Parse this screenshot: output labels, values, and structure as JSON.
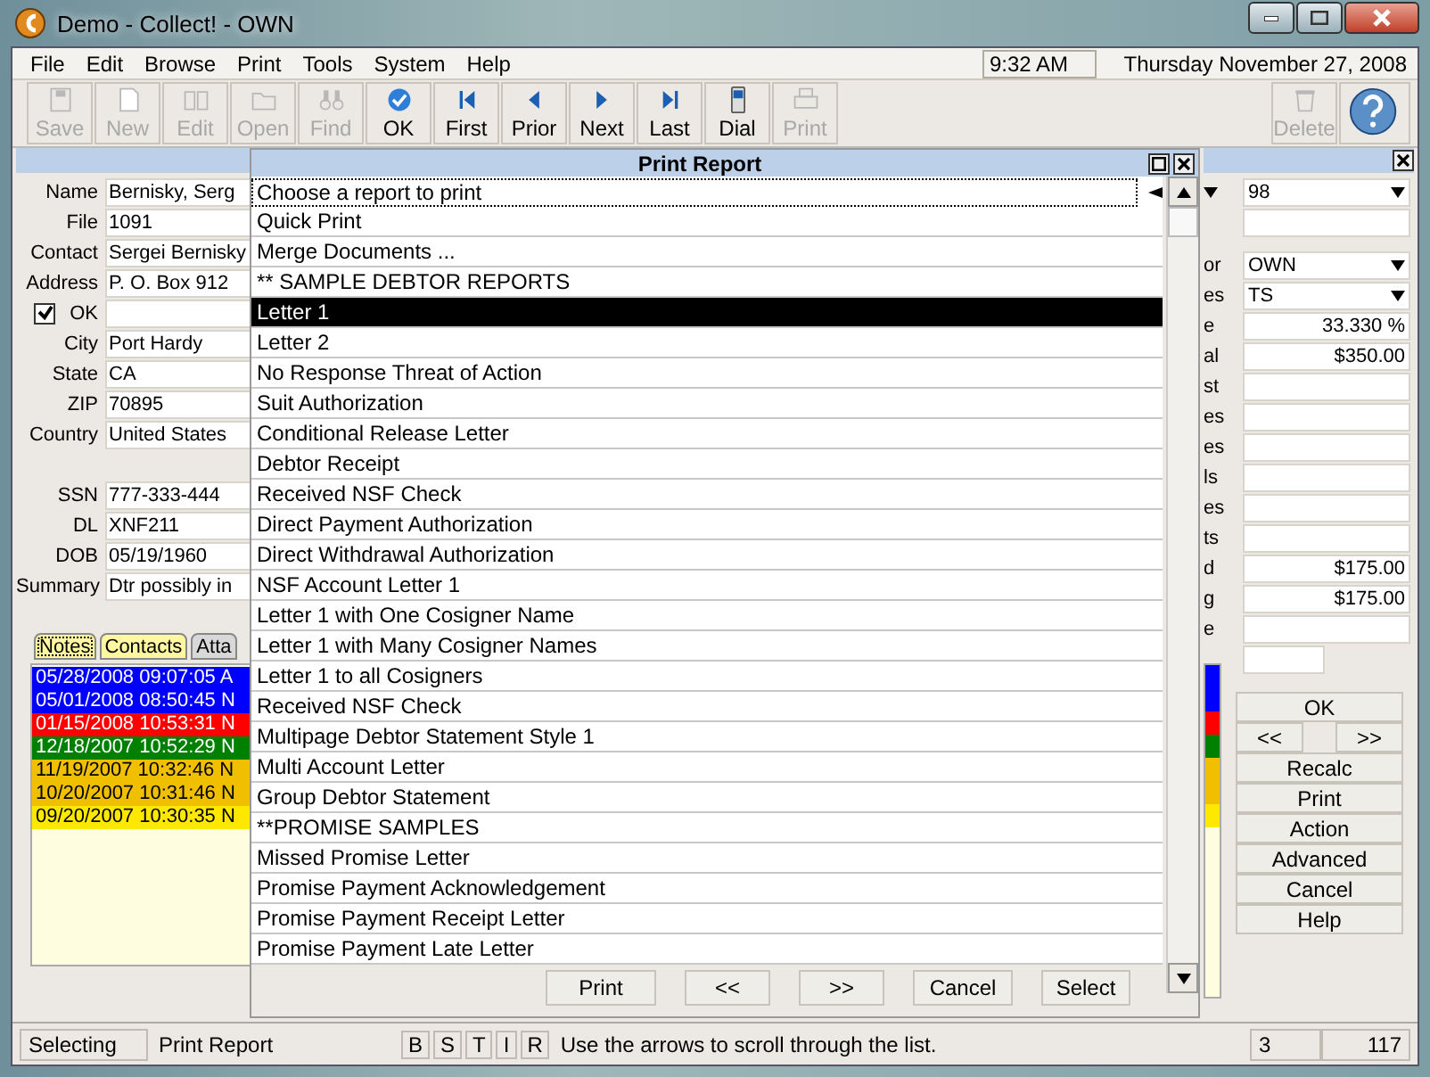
{
  "window": {
    "title": "Demo - Collect! - OWN"
  },
  "menu": [
    "File",
    "Edit",
    "Browse",
    "Print",
    "Tools",
    "System",
    "Help"
  ],
  "clock": {
    "time": "9:32 AM",
    "date": "Thursday  November 27, 2008"
  },
  "toolbar": {
    "main": [
      {
        "label": "Save",
        "kind": "save",
        "disabled": true
      },
      {
        "label": "New",
        "kind": "page",
        "disabled": true
      },
      {
        "label": "Edit",
        "kind": "book",
        "disabled": true
      },
      {
        "label": "Open",
        "kind": "folder",
        "disabled": true
      },
      {
        "label": "Find",
        "kind": "binoculars",
        "disabled": true
      },
      {
        "label": "OK",
        "kind": "check",
        "disabled": false
      },
      {
        "label": "First",
        "kind": "first",
        "disabled": false
      },
      {
        "label": "Prior",
        "kind": "prior",
        "disabled": false
      },
      {
        "label": "Next",
        "kind": "next",
        "disabled": false
      },
      {
        "label": "Last",
        "kind": "last",
        "disabled": false
      },
      {
        "label": "Dial",
        "kind": "phone",
        "disabled": false
      },
      {
        "label": "Print",
        "kind": "printer",
        "disabled": true
      }
    ],
    "end": [
      {
        "label": "Delete",
        "kind": "trash",
        "disabled": true
      },
      {
        "kind": "help"
      }
    ]
  },
  "form": {
    "fields": [
      {
        "kind": "text",
        "label": "Name",
        "value": "Bernisky, Serg"
      },
      {
        "kind": "text",
        "label": "File",
        "value": "1091"
      },
      {
        "kind": "text",
        "label": "Contact",
        "value": "Sergei Bernisky"
      },
      {
        "kind": "text",
        "label": "Address",
        "value": "P. O. Box 912"
      },
      {
        "kind": "checkbox",
        "label": "OK",
        "checked": true
      },
      {
        "kind": "text",
        "label": "City",
        "value": "Port Hardy"
      },
      {
        "kind": "text",
        "label": "State",
        "value": "CA"
      },
      {
        "kind": "text",
        "label": "ZIP",
        "value": "70895"
      },
      {
        "kind": "text",
        "label": "Country",
        "value": "United States"
      },
      {
        "kind": "gap"
      },
      {
        "kind": "text",
        "label": "SSN",
        "value": "777-333-444"
      },
      {
        "kind": "text",
        "label": "DL",
        "value": "XNF211"
      },
      {
        "kind": "text",
        "label": "DOB",
        "value": "05/19/1960"
      },
      {
        "kind": "text",
        "label": "Summary",
        "value": "Dtr possibly in"
      }
    ]
  },
  "notes_tabs": [
    {
      "label": "Notes",
      "selected": true,
      "color": "#fff8a0"
    },
    {
      "label": "Contacts",
      "selected": false,
      "color": "#fff8a0"
    },
    {
      "label": "Atta",
      "selected": false,
      "color": "#d8d8d8"
    }
  ],
  "notes": [
    {
      "text": "05/28/2008 09:07:05 A",
      "color": "#0000ff"
    },
    {
      "text": "05/01/2008 08:50:45 N",
      "color": "#0000ff"
    },
    {
      "text": "01/15/2008 10:53:31 N",
      "color": "#ff0000"
    },
    {
      "text": "12/18/2007 10:52:29 N",
      "color": "#008000"
    },
    {
      "text": "11/19/2007 10:32:46 N",
      "color": "#f0c000"
    },
    {
      "text": "10/20/2007 10:31:46 N",
      "color": "#f0c000"
    },
    {
      "text": "09/20/2007 10:30:35 N",
      "color": "#ffe800"
    }
  ],
  "right_panel": {
    "top_value": "98",
    "fields": [
      {
        "label": "or",
        "value": "OWN",
        "kind": "dropdown"
      },
      {
        "label": "es",
        "value": "TS",
        "kind": "dropdown"
      },
      {
        "label": "e",
        "value": "33.330 %",
        "kind": "number"
      },
      {
        "label": "al",
        "value": "$350.00",
        "kind": "number"
      },
      {
        "label": "st",
        "kind": "number"
      },
      {
        "label": "es",
        "kind": "number"
      },
      {
        "label": "es",
        "kind": "number"
      },
      {
        "label": "ls",
        "kind": "number"
      },
      {
        "label": "es",
        "kind": "number"
      },
      {
        "label": "ts",
        "kind": "number"
      },
      {
        "label": "d",
        "value": "$175.00",
        "kind": "number"
      },
      {
        "label": "g",
        "value": "$175.00",
        "kind": "number"
      },
      {
        "label": "e",
        "kind": "number"
      }
    ],
    "buttons": [
      {
        "label": "OK",
        "kind": "wide"
      },
      {
        "label": "<<",
        "kind": "pair"
      },
      {
        "label": ">>",
        "kind": "pair"
      },
      {
        "label": "Recalc",
        "kind": "wide"
      },
      {
        "label": "Print",
        "kind": "wide"
      },
      {
        "label": "Action",
        "kind": "wide"
      },
      {
        "label": "Advanced",
        "kind": "wide"
      },
      {
        "label": "Cancel",
        "kind": "wide"
      },
      {
        "label": "Help",
        "kind": "wide"
      }
    ]
  },
  "dialog": {
    "title": "Print Report",
    "prompt": "Choose a report to print",
    "items": [
      {
        "label": "Quick Print",
        "selected": false
      },
      {
        "label": "Merge Documents ...",
        "selected": false
      },
      {
        "label": "** SAMPLE DEBTOR REPORTS",
        "selected": false
      },
      {
        "label": "Letter 1",
        "selected": true
      },
      {
        "label": "Letter 2",
        "selected": false
      },
      {
        "label": "No Response Threat of Action",
        "selected": false
      },
      {
        "label": "Suit Authorization",
        "selected": false
      },
      {
        "label": "Conditional Release Letter",
        "selected": false
      },
      {
        "label": "Debtor Receipt",
        "selected": false
      },
      {
        "label": "Received NSF Check",
        "selected": false
      },
      {
        "label": "Direct Payment Authorization",
        "selected": false
      },
      {
        "label": "Direct Withdrawal Authorization",
        "selected": false
      },
      {
        "label": "NSF Account Letter 1",
        "selected": false
      },
      {
        "label": "Letter 1 with One Cosigner Name",
        "selected": false
      },
      {
        "label": "Letter 1 with Many Cosigner Names",
        "selected": false
      },
      {
        "label": "Letter 1 to all Cosigners",
        "selected": false
      },
      {
        "label": "Received NSF Check",
        "selected": false
      },
      {
        "label": "Multipage Debtor Statement Style 1",
        "selected": false
      },
      {
        "label": "Multi Account Letter",
        "selected": false
      },
      {
        "label": "Group Debtor Statement",
        "selected": false
      },
      {
        "label": "**PROMISE SAMPLES",
        "selected": false
      },
      {
        "label": "Missed Promise Letter",
        "selected": false
      },
      {
        "label": "Promise Payment Acknowledgement",
        "selected": false
      },
      {
        "label": "Promise Payment Receipt Letter",
        "selected": false
      },
      {
        "label": "Promise Payment Late Letter",
        "selected": false
      }
    ],
    "buttons": [
      "Print",
      "<<",
      ">>",
      "Cancel",
      "Select"
    ]
  },
  "status_bar": {
    "mode": "Selecting",
    "context": "Print Report",
    "flags": [
      "B",
      "S",
      "T",
      "I",
      "R"
    ],
    "message": "Use the arrows to scroll through the list.",
    "record": "3",
    "total": "117"
  }
}
